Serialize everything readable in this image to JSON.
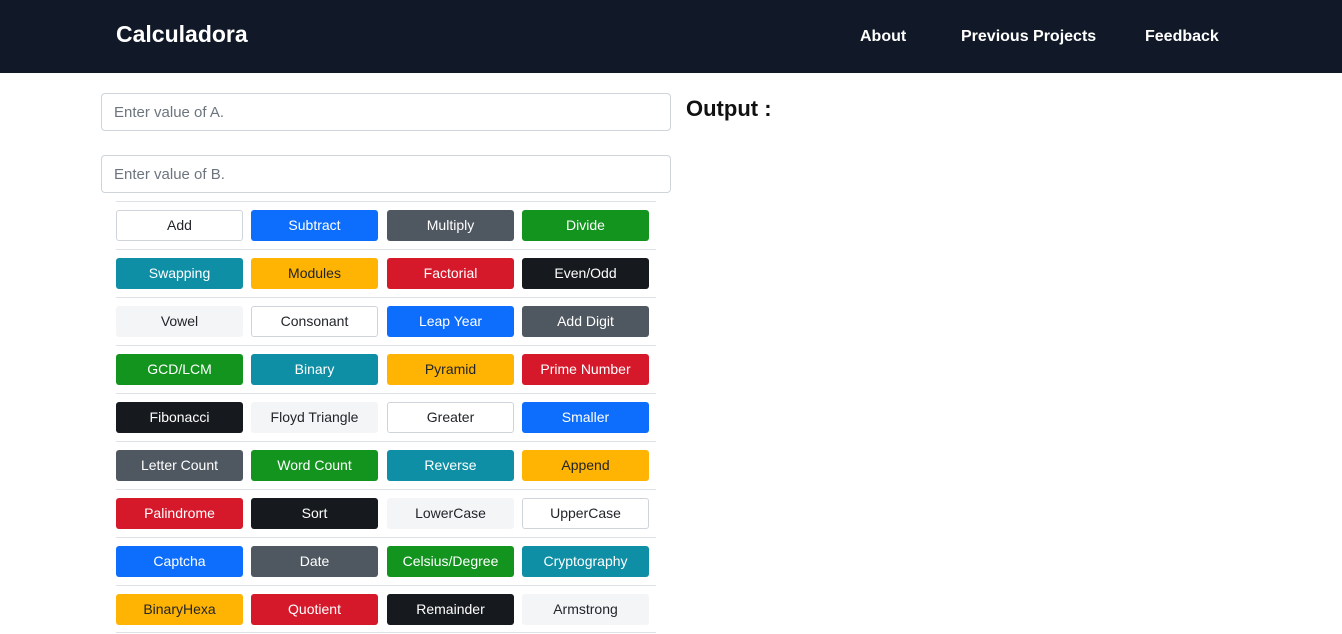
{
  "navbar": {
    "brand": "Calculadora",
    "links": [
      "About",
      "Previous Projects",
      "Feedback"
    ]
  },
  "inputs": {
    "a_placeholder": "Enter value of A.",
    "b_placeholder": "Enter value of B."
  },
  "output": {
    "heading": "Output :"
  },
  "colors": {
    "navbar_bg": "#111827",
    "primary": "#0d6efd",
    "secondary": "#4f5760",
    "success": "#13941f",
    "info": "#0e8fa5",
    "warning": "#ffb302",
    "danger": "#d5182a",
    "dark": "#16191d",
    "light": "#f4f5f7"
  },
  "buttons": [
    [
      {
        "label": "Add",
        "variant": "outline"
      },
      {
        "label": "Subtract",
        "variant": "primary"
      },
      {
        "label": "Multiply",
        "variant": "secondary"
      },
      {
        "label": "Divide",
        "variant": "success"
      }
    ],
    [
      {
        "label": "Swapping",
        "variant": "info"
      },
      {
        "label": "Modules",
        "variant": "warning"
      },
      {
        "label": "Factorial",
        "variant": "danger"
      },
      {
        "label": "Even/Odd",
        "variant": "dark"
      }
    ],
    [
      {
        "label": "Vowel",
        "variant": "light"
      },
      {
        "label": "Consonant",
        "variant": "outline"
      },
      {
        "label": "Leap Year",
        "variant": "primary"
      },
      {
        "label": "Add Digit",
        "variant": "secondary"
      }
    ],
    [
      {
        "label": "GCD/LCM",
        "variant": "success"
      },
      {
        "label": "Binary",
        "variant": "info"
      },
      {
        "label": "Pyramid",
        "variant": "warning"
      },
      {
        "label": "Prime Number",
        "variant": "danger"
      }
    ],
    [
      {
        "label": "Fibonacci",
        "variant": "dark"
      },
      {
        "label": "Floyd Triangle",
        "variant": "light"
      },
      {
        "label": "Greater",
        "variant": "outline"
      },
      {
        "label": "Smaller",
        "variant": "primary"
      }
    ],
    [
      {
        "label": "Letter Count",
        "variant": "secondary"
      },
      {
        "label": "Word Count",
        "variant": "success"
      },
      {
        "label": "Reverse",
        "variant": "info"
      },
      {
        "label": "Append",
        "variant": "warning"
      }
    ],
    [
      {
        "label": "Palindrome",
        "variant": "danger"
      },
      {
        "label": "Sort",
        "variant": "dark"
      },
      {
        "label": "LowerCase",
        "variant": "light"
      },
      {
        "label": "UpperCase",
        "variant": "outline"
      }
    ],
    [
      {
        "label": "Captcha",
        "variant": "primary"
      },
      {
        "label": "Date",
        "variant": "secondary"
      },
      {
        "label": "Celsius/Degree",
        "variant": "success"
      },
      {
        "label": "Cryptography",
        "variant": "info"
      }
    ],
    [
      {
        "label": "BinaryHexa",
        "variant": "warning"
      },
      {
        "label": "Quotient",
        "variant": "danger"
      },
      {
        "label": "Remainder",
        "variant": "dark"
      },
      {
        "label": "Armstrong",
        "variant": "light"
      }
    ]
  ]
}
